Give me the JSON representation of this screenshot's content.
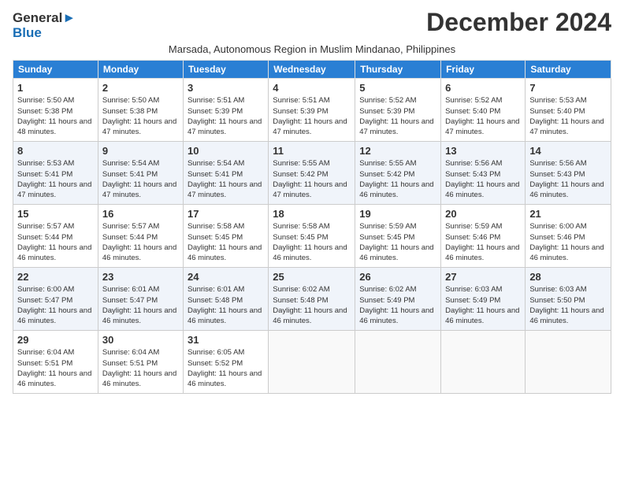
{
  "logo": {
    "line1": "General",
    "line2": "Blue"
  },
  "title": "December 2024",
  "subtitle": "Marsada, Autonomous Region in Muslim Mindanao, Philippines",
  "weekdays": [
    "Sunday",
    "Monday",
    "Tuesday",
    "Wednesday",
    "Thursday",
    "Friday",
    "Saturday"
  ],
  "weeks": [
    [
      {
        "day": "1",
        "rise": "5:50 AM",
        "set": "5:38 PM",
        "daylight": "11 hours and 48 minutes."
      },
      {
        "day": "2",
        "rise": "5:50 AM",
        "set": "5:38 PM",
        "daylight": "11 hours and 47 minutes."
      },
      {
        "day": "3",
        "rise": "5:51 AM",
        "set": "5:39 PM",
        "daylight": "11 hours and 47 minutes."
      },
      {
        "day": "4",
        "rise": "5:51 AM",
        "set": "5:39 PM",
        "daylight": "11 hours and 47 minutes."
      },
      {
        "day": "5",
        "rise": "5:52 AM",
        "set": "5:39 PM",
        "daylight": "11 hours and 47 minutes."
      },
      {
        "day": "6",
        "rise": "5:52 AM",
        "set": "5:40 PM",
        "daylight": "11 hours and 47 minutes."
      },
      {
        "day": "7",
        "rise": "5:53 AM",
        "set": "5:40 PM",
        "daylight": "11 hours and 47 minutes."
      }
    ],
    [
      {
        "day": "8",
        "rise": "5:53 AM",
        "set": "5:41 PM",
        "daylight": "11 hours and 47 minutes."
      },
      {
        "day": "9",
        "rise": "5:54 AM",
        "set": "5:41 PM",
        "daylight": "11 hours and 47 minutes."
      },
      {
        "day": "10",
        "rise": "5:54 AM",
        "set": "5:41 PM",
        "daylight": "11 hours and 47 minutes."
      },
      {
        "day": "11",
        "rise": "5:55 AM",
        "set": "5:42 PM",
        "daylight": "11 hours and 47 minutes."
      },
      {
        "day": "12",
        "rise": "5:55 AM",
        "set": "5:42 PM",
        "daylight": "11 hours and 46 minutes."
      },
      {
        "day": "13",
        "rise": "5:56 AM",
        "set": "5:43 PM",
        "daylight": "11 hours and 46 minutes."
      },
      {
        "day": "14",
        "rise": "5:56 AM",
        "set": "5:43 PM",
        "daylight": "11 hours and 46 minutes."
      }
    ],
    [
      {
        "day": "15",
        "rise": "5:57 AM",
        "set": "5:44 PM",
        "daylight": "11 hours and 46 minutes."
      },
      {
        "day": "16",
        "rise": "5:57 AM",
        "set": "5:44 PM",
        "daylight": "11 hours and 46 minutes."
      },
      {
        "day": "17",
        "rise": "5:58 AM",
        "set": "5:45 PM",
        "daylight": "11 hours and 46 minutes."
      },
      {
        "day": "18",
        "rise": "5:58 AM",
        "set": "5:45 PM",
        "daylight": "11 hours and 46 minutes."
      },
      {
        "day": "19",
        "rise": "5:59 AM",
        "set": "5:45 PM",
        "daylight": "11 hours and 46 minutes."
      },
      {
        "day": "20",
        "rise": "5:59 AM",
        "set": "5:46 PM",
        "daylight": "11 hours and 46 minutes."
      },
      {
        "day": "21",
        "rise": "6:00 AM",
        "set": "5:46 PM",
        "daylight": "11 hours and 46 minutes."
      }
    ],
    [
      {
        "day": "22",
        "rise": "6:00 AM",
        "set": "5:47 PM",
        "daylight": "11 hours and 46 minutes."
      },
      {
        "day": "23",
        "rise": "6:01 AM",
        "set": "5:47 PM",
        "daylight": "11 hours and 46 minutes."
      },
      {
        "day": "24",
        "rise": "6:01 AM",
        "set": "5:48 PM",
        "daylight": "11 hours and 46 minutes."
      },
      {
        "day": "25",
        "rise": "6:02 AM",
        "set": "5:48 PM",
        "daylight": "11 hours and 46 minutes."
      },
      {
        "day": "26",
        "rise": "6:02 AM",
        "set": "5:49 PM",
        "daylight": "11 hours and 46 minutes."
      },
      {
        "day": "27",
        "rise": "6:03 AM",
        "set": "5:49 PM",
        "daylight": "11 hours and 46 minutes."
      },
      {
        "day": "28",
        "rise": "6:03 AM",
        "set": "5:50 PM",
        "daylight": "11 hours and 46 minutes."
      }
    ],
    [
      {
        "day": "29",
        "rise": "6:04 AM",
        "set": "5:51 PM",
        "daylight": "11 hours and 46 minutes."
      },
      {
        "day": "30",
        "rise": "6:04 AM",
        "set": "5:51 PM",
        "daylight": "11 hours and 46 minutes."
      },
      {
        "day": "31",
        "rise": "6:05 AM",
        "set": "5:52 PM",
        "daylight": "11 hours and 46 minutes."
      },
      null,
      null,
      null,
      null
    ]
  ]
}
